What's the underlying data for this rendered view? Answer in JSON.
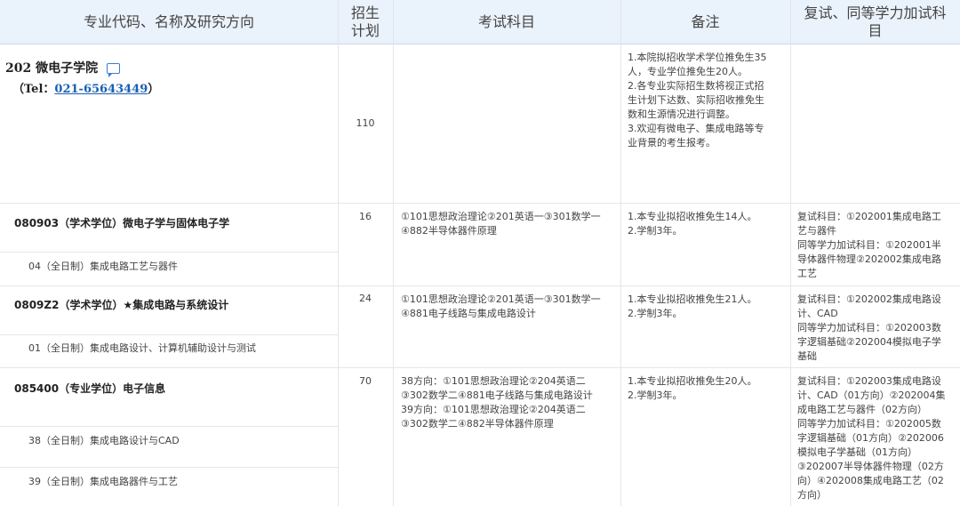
{
  "header": {
    "col1": "专业代码、名称及研究方向",
    "col2_line1": "招生",
    "col2_line2": "计划",
    "col3": "考试科目",
    "col4": "备注",
    "col5_line1": "复试、同等学力加试科",
    "col5_line2": "目"
  },
  "college": {
    "name": "202 微电子学院",
    "tel_prefix": "（Tel：",
    "tel_number": "021-65643449",
    "tel_suffix": "）",
    "plan": "110",
    "notes": [
      "1.本院拟招收学术学位推免生35",
      "人，专业学位推免生20人。",
      "2.各专业实际招生数将视正式招",
      "生计划下达数、实际招收推免生",
      "数和生源情况进行调整。",
      "3.欢迎有微电子、集成电路等专",
      "业背景的考生报考。"
    ]
  },
  "majors": [
    {
      "title": "080903（学术学位）微电子学与固体电子学",
      "plan": "16",
      "exam": [
        "①101思想政治理论②201英语一③301数学一",
        "④882半导体器件原理"
      ],
      "notes": [
        "1.本专业拟招收推免生14人。",
        "2.学制3年。"
      ],
      "retest": [
        "复试科目：①202001集成电路工",
        "艺与器件",
        "同等学力加试科目：①202001半",
        "导体器件物理②202002集成电路",
        "工艺"
      ],
      "directions": [
        "04（全日制）集成电路工艺与器件"
      ]
    },
    {
      "title": "0809Z2（学术学位）★集成电路与系统设计",
      "plan": "24",
      "exam": [
        "①101思想政治理论②201英语一③301数学一",
        "④881电子线路与集成电路设计"
      ],
      "notes": [
        "1.本专业拟招收推免生21人。",
        "2.学制3年。"
      ],
      "retest": [
        "复试科目：①202002集成电路设",
        "计、CAD",
        "同等学力加试科目：①202003数",
        "字逻辑基础②202004模拟电子学",
        "基础"
      ],
      "directions": [
        "01（全日制）集成电路设计、计算机辅助设计与测试"
      ]
    },
    {
      "title": "085400（专业学位）电子信息",
      "plan": "70",
      "exam": [
        "38方向：①101思想政治理论②204英语二",
        "③302数学二④881电子线路与集成电路设计",
        "39方向：①101思想政治理论②204英语二",
        "③302数学二④882半导体器件原理"
      ],
      "notes": [
        "1.本专业拟招收推免生20人。",
        "2.学制3年。"
      ],
      "retest": [
        "复试科目：①202003集成电路设",
        "计、CAD（01方向）②202004集",
        "成电路工艺与器件（02方向）",
        "同等学力加试科目：①202005数",
        "字逻辑基础（01方向）②202006",
        "模拟电子学基础（01方向）",
        "③202007半导体器件物理（02方",
        "向）④202008集成电路工艺（02",
        "方向）"
      ],
      "directions": [
        "38（全日制）集成电路设计与CAD",
        "39（全日制）集成电路器件与工艺"
      ]
    }
  ]
}
